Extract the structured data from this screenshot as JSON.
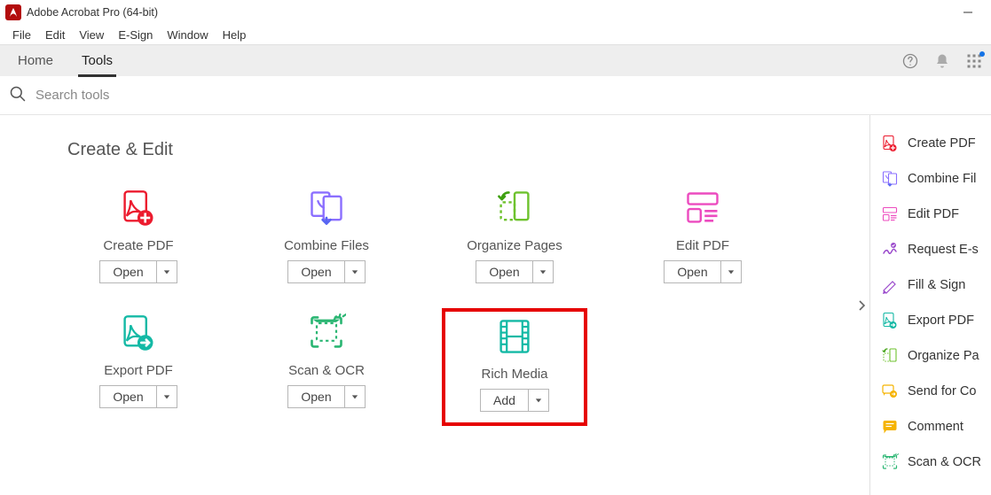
{
  "window": {
    "title": "Adobe Acrobat Pro (64-bit)"
  },
  "menubar": [
    "File",
    "Edit",
    "View",
    "E-Sign",
    "Window",
    "Help"
  ],
  "tabs": {
    "home": "Home",
    "tools": "Tools",
    "active": "tools"
  },
  "search": {
    "placeholder": "Search tools"
  },
  "section": {
    "title": "Create & Edit"
  },
  "tools": [
    {
      "id": "create-pdf",
      "label": "Create PDF",
      "button": "Open",
      "icon": "create-pdf",
      "highlight": false
    },
    {
      "id": "combine-files",
      "label": "Combine Files",
      "button": "Open",
      "icon": "combine-files",
      "highlight": false
    },
    {
      "id": "organize-pages",
      "label": "Organize Pages",
      "button": "Open",
      "icon": "organize-pages",
      "highlight": false
    },
    {
      "id": "edit-pdf",
      "label": "Edit PDF",
      "button": "Open",
      "icon": "edit-pdf",
      "highlight": false
    },
    {
      "id": "export-pdf",
      "label": "Export PDF",
      "button": "Open",
      "icon": "export-pdf",
      "highlight": false
    },
    {
      "id": "scan-ocr",
      "label": "Scan & OCR",
      "button": "Open",
      "icon": "scan-ocr",
      "highlight": false
    },
    {
      "id": "rich-media",
      "label": "Rich Media",
      "button": "Add",
      "icon": "rich-media",
      "highlight": true
    }
  ],
  "sidebar": [
    {
      "id": "create-pdf",
      "label": "Create PDF",
      "icon": "create-pdf",
      "color": "#e8467c"
    },
    {
      "id": "combine",
      "label": "Combine Fil",
      "icon": "combine-files",
      "color": "#5865f2"
    },
    {
      "id": "edit-pdf",
      "label": "Edit PDF",
      "icon": "edit-pdf",
      "color": "#e8467c"
    },
    {
      "id": "request-es",
      "label": "Request E-s",
      "icon": "request-sign",
      "color": "#9b4bcc"
    },
    {
      "id": "fill-sign",
      "label": "Fill & Sign",
      "icon": "fill-sign",
      "color": "#9b4bcc"
    },
    {
      "id": "export-pdf",
      "label": "Export PDF",
      "icon": "export-pdf",
      "color": "#14a085"
    },
    {
      "id": "organize",
      "label": "Organize Pa",
      "icon": "organize-pages",
      "color": "#6ec22e"
    },
    {
      "id": "send-comments",
      "label": "Send for Co",
      "icon": "send-comments",
      "color": "#f5b301"
    },
    {
      "id": "comment",
      "label": "Comment",
      "icon": "comment",
      "color": "#f5b301"
    },
    {
      "id": "scan-ocr",
      "label": "Scan & OCR",
      "icon": "scan-ocr",
      "color": "#14a085"
    }
  ],
  "colors": {
    "accent_red": "#ec1b2e",
    "purple": "#8b6fff",
    "green": "#6ec22e",
    "pink": "#ec4bbf",
    "teal": "#14b9a5",
    "emerald": "#2bb673"
  }
}
